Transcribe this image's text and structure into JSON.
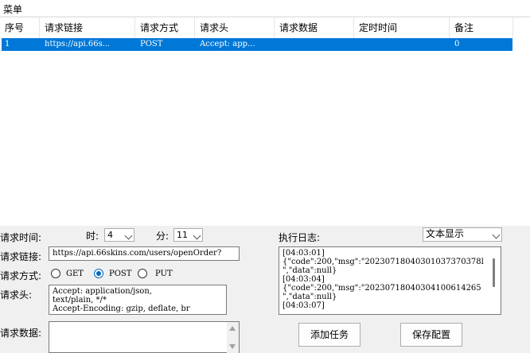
{
  "menu": {
    "label": "菜单"
  },
  "table": {
    "columns": [
      "序号",
      "请求链接",
      "请求方式",
      "请求头",
      "请求数据",
      "定时时间",
      "备注"
    ],
    "rows": [
      {
        "no": "1",
        "url": "https://api.66s...",
        "method": "POST",
        "headers": "Accept: app...",
        "data": "",
        "time": "",
        "note": "0"
      }
    ]
  },
  "form": {
    "time_label": "请求时间:",
    "hour_label": "时:",
    "hour_value": "4",
    "minute_label": "分:",
    "minute_value": "11",
    "url_label": "请求链接:",
    "url_value": "https://api.66skins.com/users/openOrder?",
    "method_label": "请求方式:",
    "methods": [
      "GET",
      "POST",
      "PUT"
    ],
    "selected_method": "POST",
    "header_label": "请求头:",
    "header_value": "Accept: application/json,\ntext/plain, */*\nAccept-Encoding: gzip, deflate, br",
    "data_label": "请求数据:",
    "data_value": ""
  },
  "log": {
    "label": "执行日志:",
    "mode_value": "文本显示",
    "content": "[04:03:01]\n{\"code\":200,\"msg\":\"20230718040301037370378l\n\",\"data\":null}\n[04:03:04]\n{\"code\":200,\"msg\":\"20230718040304100614265\n\",\"data\":null}\n[04:03:07]"
  },
  "buttons": {
    "add_task": "添加任务",
    "save_config": "保存配置"
  }
}
